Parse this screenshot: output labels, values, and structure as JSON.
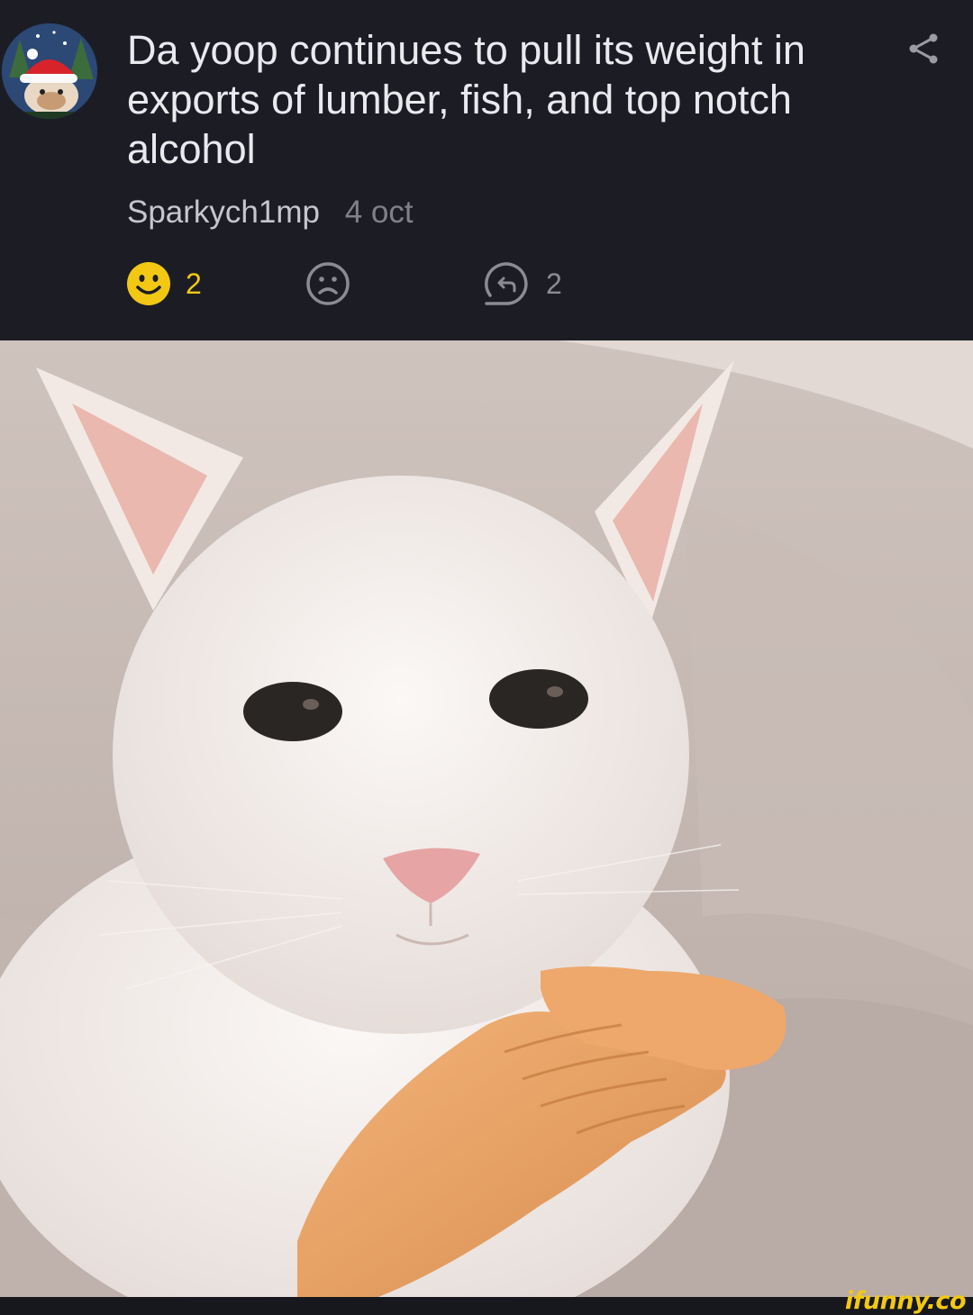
{
  "comment": {
    "text": "Da yoop continues to pull its weight in exports of lumber, fish, and top notch alcohol",
    "author": "Sparkych1mp",
    "date": "4 oct",
    "avatar_icon": "santa-hat-dog-avatar-icon",
    "share_icon": "share-icon"
  },
  "actions": {
    "smile_count": "2",
    "frown_count": "",
    "reply_count": "2"
  },
  "colors": {
    "background": "#1c1d24",
    "accent_yellow": "#f2c814",
    "text": "#e9e9ee",
    "muted": "#7f808a"
  },
  "watermark": "ifunny.co"
}
